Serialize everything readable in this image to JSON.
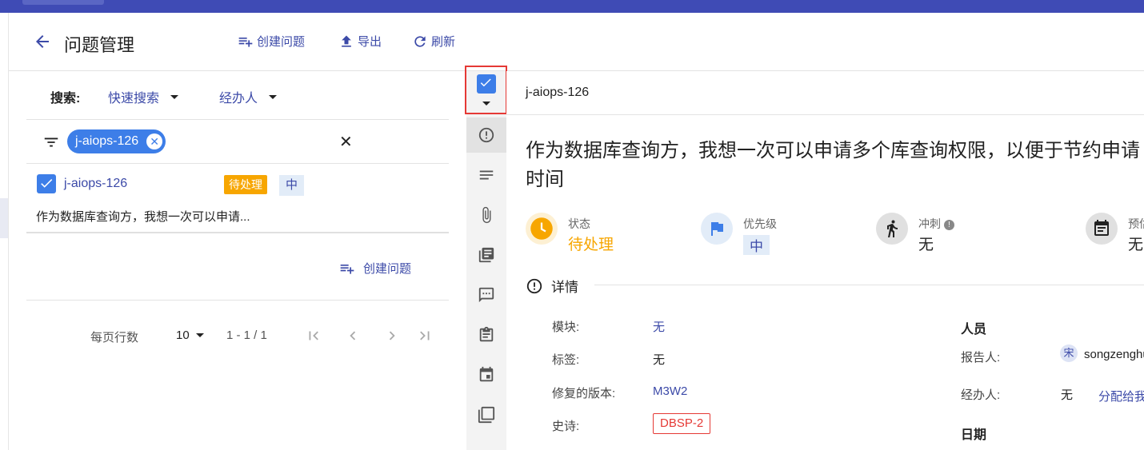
{
  "header": {
    "title": "问题管理",
    "create_label": "创建问题",
    "export_label": "导出",
    "refresh_label": "刷新"
  },
  "search": {
    "label": "搜索:",
    "quick_search": "快速搜索",
    "assignee": "经办人"
  },
  "filter": {
    "chip": "j-aiops-126"
  },
  "issue_list": [
    {
      "key": "j-aiops-126",
      "status": "待处理",
      "priority": "中",
      "summary": "作为数据库查询方，我想一次可以申请..."
    }
  ],
  "create_link": "创建问题",
  "pagination": {
    "rows_per_page_label": "每页行数",
    "rows_per_page": "10",
    "range": "1 - 1 / 1"
  },
  "detail": {
    "key": "j-aiops-126",
    "title": "作为数据库查询方，我想一次可以申请多个库查询权限，以便于节约申请时间",
    "meta": {
      "status_label": "状态",
      "status_value": "待处理",
      "priority_label": "优先级",
      "priority_value": "中",
      "sprint_label": "冲刺",
      "sprint_value": "无",
      "estimate_label": "预估",
      "estimate_value": "无"
    },
    "section_title": "详情",
    "fields": {
      "module_label": "模块:",
      "module_value": "无",
      "tags_label": "标签:",
      "tags_value": "无",
      "fix_version_label": "修复的版本:",
      "fix_version_value": "M3W2",
      "epic_label": "史诗:",
      "epic_value": "DBSP-2"
    },
    "people": {
      "heading": "人员",
      "reporter_label": "报告人:",
      "reporter_avatar": "宋",
      "reporter_name": "songzenghui",
      "assignee_label": "经办人:",
      "assignee_value": "无",
      "assign_link": "分配给我"
    },
    "dates_heading": "日期"
  },
  "colors": {
    "primary": "#3c4aa8",
    "topbar": "#3f4bb5",
    "status_orange": "#f7a600",
    "chip_blue": "#3d7ee8",
    "highlight_red": "#e53935"
  }
}
